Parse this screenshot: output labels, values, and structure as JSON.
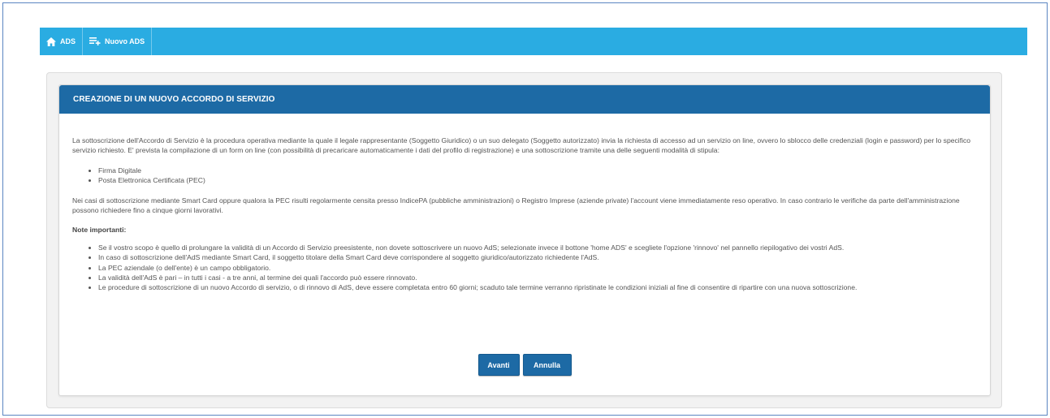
{
  "nav": {
    "home_label": "ADS",
    "new_label": "Nuovo ADS"
  },
  "card": {
    "title": "CREAZIONE DI UN NUOVO ACCORDO DI SERVIZIO",
    "intro": "La sottoscrizione dell'Accordo di Servizio è la procedura operativa mediante la quale il legale rappresentante (Soggetto Giuridico) o un suo delegato (Soggetto autorizzato) invia la richiesta di accesso ad un servizio on line, ovvero lo sblocco delle credenziali (login e password) per lo specifico servizio richiesto. E' prevista la compilazione di un form on line (con possibilità di precaricare automaticamente i dati del profilo di registrazione) e una sottoscrizione tramite una delle seguenti modalità di stipula:",
    "methods": [
      "Firma Digitale",
      "Posta Elettronica Certificata (PEC)"
    ],
    "paragraph2": "Nei casi di sottoscrizione mediante Smart Card oppure qualora la PEC risulti regolarmente censita presso IndicePA (pubbliche amministrazioni) o Registro Imprese (aziende private) l'account viene immediatamente reso operativo. In caso contrario le verifiche da parte dell'amministrazione possono richiedere fino a cinque giorni lavorativi.",
    "notes_title": "Note importanti:",
    "notes": [
      "Se il vostro scopo è quello di prolungare la validità di un Accordo di Servizio preesistente, non dovete sottoscrivere un nuovo AdS; selezionate invece il bottone 'home ADS' e scegliete l'opzione 'rinnovo' nel pannello riepilogativo dei vostri AdS.",
      "In caso di sottoscrizione dell'AdS mediante Smart Card, il soggetto titolare della Smart Card deve corrispondere al soggetto giuridico/autorizzato richiedente l'AdS.",
      "La PEC aziendale (o dell'ente) è un campo obbligatorio.",
      "La validità dell'AdS è pari – in tutti i casi - a tre anni, al termine dei quali l'accordo può essere rinnovato.",
      "Le procedure di sottoscrizione di un nuovo Accordo di servizio, o di rinnovo di AdS, deve essere completata entro 60 giorni; scaduto tale termine verranno ripristinate le condizioni iniziali al fine di consentire di ripartire con una nuova sottoscrizione."
    ],
    "btn_next": "Avanti",
    "btn_cancel": "Annulla"
  },
  "colors": {
    "navbar": "#2aace2",
    "header": "#1d6aa5",
    "button": "#1d6aa5"
  }
}
